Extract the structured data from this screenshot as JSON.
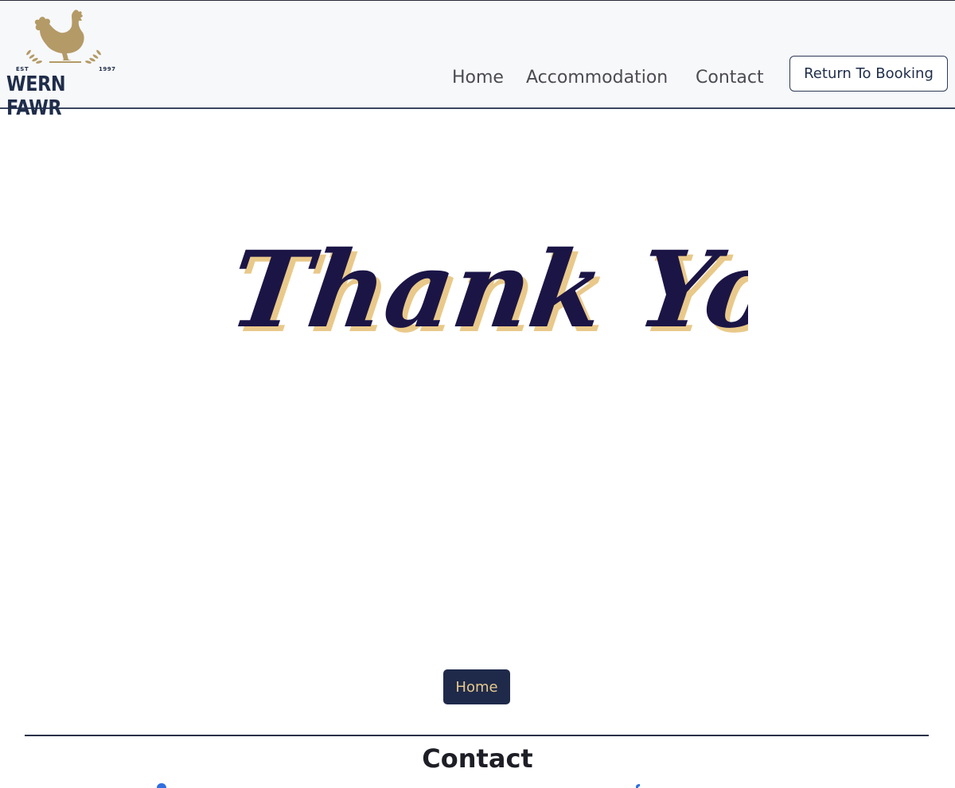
{
  "header": {
    "logo": {
      "est": "EST",
      "year": "1997",
      "name": "WERN FAWR",
      "icon": "rooster-icon",
      "gold": "#b49a66",
      "navy": "#1f2d4a"
    },
    "nav": {
      "home": "Home",
      "accommodation": "Accommodation",
      "contact": "Contact"
    },
    "return_button": "Return To Booking"
  },
  "main": {
    "banner_text": "Thank You",
    "banner_colors": {
      "ink": "#1b1546",
      "shadow": "#e9c98a"
    },
    "home_button": "Home"
  },
  "footer": {
    "heading": "Contact",
    "icons": [
      "location-icon",
      "facebook-icon"
    ],
    "icon_color": "#2f6fe0"
  }
}
